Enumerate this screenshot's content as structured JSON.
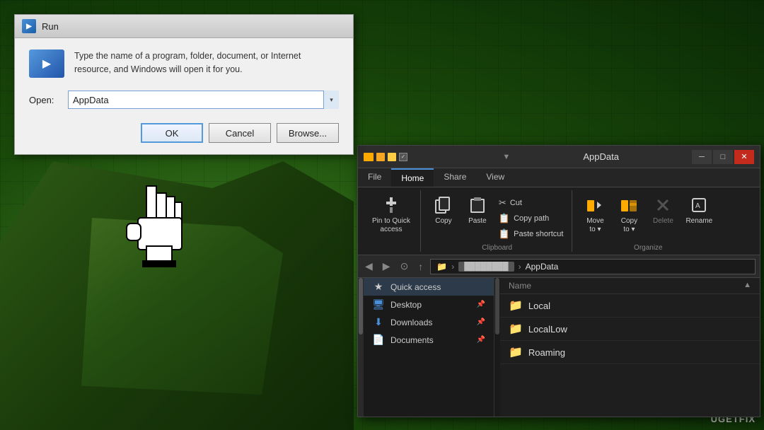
{
  "background": {
    "color": "#2a5a1a"
  },
  "run_dialog": {
    "title": "Run",
    "description": "Type the name of a program, folder, document, or Internet resource, and Windows will open it for you.",
    "open_label": "Open:",
    "input_value": "AppData",
    "ok_label": "OK",
    "cancel_label": "Cancel",
    "browse_label": "Browse..."
  },
  "explorer": {
    "title": "AppData",
    "tabs": {
      "file": "File",
      "home": "Home",
      "share": "Share",
      "view": "View"
    },
    "ribbon": {
      "pin_label": "Pin to Quick\naccess",
      "copy_label": "Copy",
      "paste_label": "Paste",
      "cut_label": "Cut",
      "copy_path_label": "Copy path",
      "paste_shortcut_label": "Paste shortcut",
      "move_to_label": "Move\nto",
      "copy_to_label": "Copy\nto",
      "delete_label": "Delete",
      "rename_label": "Rename",
      "clipboard_group": "Clipboard",
      "organize_group": "Organize"
    },
    "address": {
      "path": "AppData"
    },
    "sidebar": {
      "quick_access_label": "Quick access",
      "items": [
        {
          "name": "Desktop",
          "icon": "🖥",
          "pinned": true
        },
        {
          "name": "Downloads",
          "icon": "⬇",
          "pinned": true
        },
        {
          "name": "Documents",
          "icon": "📄",
          "pinned": true
        }
      ]
    },
    "files": {
      "col_name": "Name",
      "items": [
        {
          "name": "Local",
          "icon": "📁"
        },
        {
          "name": "LocalLow",
          "icon": "📁"
        },
        {
          "name": "Roaming",
          "icon": "📁"
        }
      ]
    }
  },
  "watermark": {
    "text": "UGETFIX"
  }
}
